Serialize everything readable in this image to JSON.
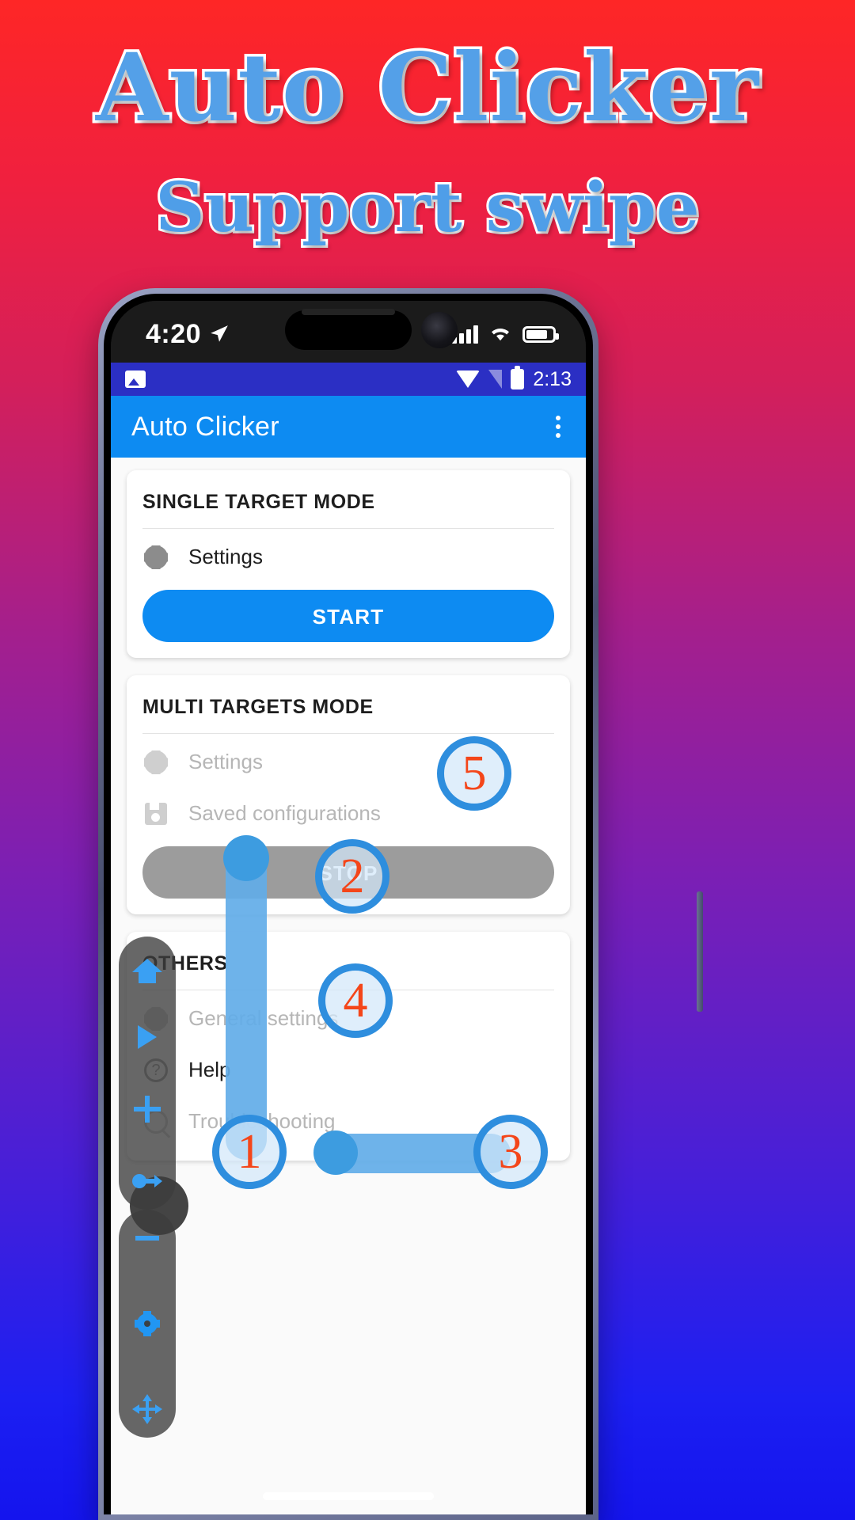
{
  "promo": {
    "title": "Auto Clicker",
    "subtitle": "Support swipe",
    "title_color": "#54a0e8",
    "outline_color": "#ffffff",
    "bg_top_color": "#fe2626",
    "bg_bottom_color": "#1414ee"
  },
  "ios_status": {
    "time": "4:20",
    "location_icon": "location-arrow-icon",
    "signal_icon": "cellular-signal-icon",
    "wifi_icon": "wifi-icon",
    "battery_icon": "battery-icon"
  },
  "android_status": {
    "time": "2:13",
    "left_icon": "image-notification-icon",
    "wifi_icon": "wifi-icon",
    "signal_icon": "signal-off-icon",
    "battery_icon": "battery-icon",
    "bar_color": "#2b2fc4"
  },
  "appbar": {
    "title": "Auto Clicker",
    "overflow_icon": "kebab-menu-icon",
    "color": "#0d8bf2"
  },
  "cards": [
    {
      "title": "SINGLE TARGET MODE",
      "rows": [
        {
          "label": "Settings",
          "icon": "gear-icon",
          "dim": false
        }
      ],
      "button": {
        "label": "START",
        "style": "primary",
        "color": "#0d8bf2"
      }
    },
    {
      "title": "MULTI TARGETS MODE",
      "rows": [
        {
          "label": "Settings",
          "icon": "gear-icon",
          "dim": true
        },
        {
          "label": "Saved configurations",
          "icon": "save-icon",
          "dim": true
        }
      ],
      "button": {
        "label": "STOP",
        "style": "disabled",
        "color": "#9c9c9c"
      }
    },
    {
      "title": "OTHERS",
      "rows": [
        {
          "label": "General settings",
          "icon": "gear-icon",
          "dim": true
        },
        {
          "label": "Help",
          "icon": "help-icon",
          "dim": false
        },
        {
          "label": "Troubleshooting",
          "icon": "troubleshooting-icon",
          "dim": true
        }
      ],
      "button": null
    }
  ],
  "floating_toolbar": {
    "accent_color": "#3aa0f3",
    "background": "rgba(60,60,60,.78)",
    "items": [
      {
        "icon": "home-icon"
      },
      {
        "icon": "play-icon"
      },
      {
        "icon": "plus-icon"
      },
      {
        "icon": "swipe-icon"
      },
      {
        "icon": "minus-icon"
      },
      {
        "icon": "gear-icon"
      },
      {
        "icon": "move-icon"
      }
    ]
  },
  "swipe_markers": [
    {
      "number": "1"
    },
    {
      "number": "2"
    },
    {
      "number": "3"
    },
    {
      "number": "4"
    },
    {
      "number": "5"
    }
  ],
  "marker_colors": {
    "ring": "#2e8ede",
    "number": "#f4461a",
    "path": "#62ade8"
  }
}
